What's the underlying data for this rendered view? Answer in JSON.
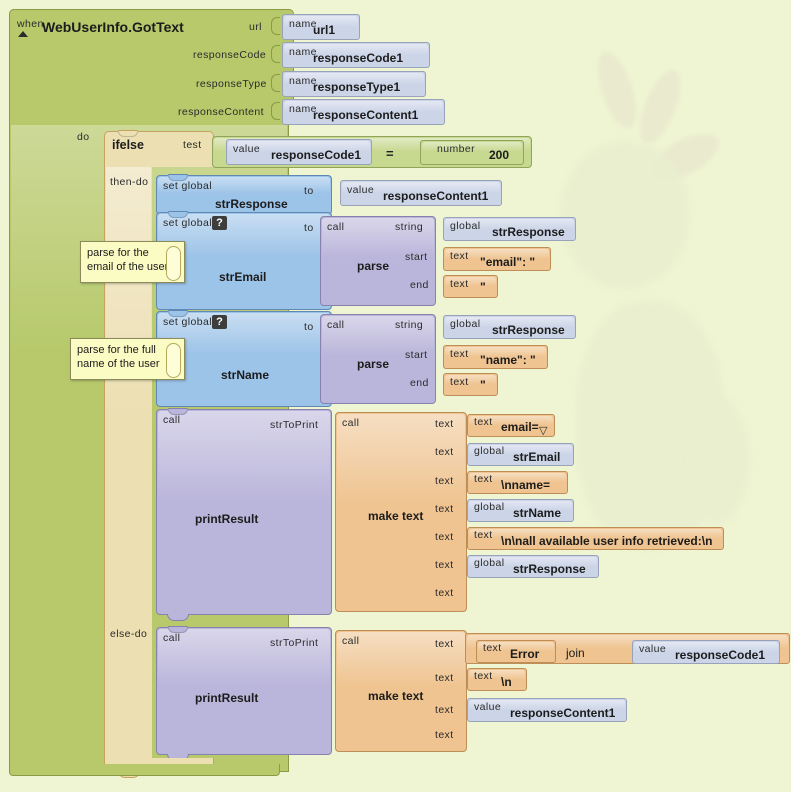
{
  "workspace": {
    "background_color": "#eff4d2",
    "watermark": "app-inventor-logo-watermark"
  },
  "event_block": {
    "type": "event",
    "color": "#b7c96b",
    "when_label": "when",
    "title": "WebUserInfo.GotText",
    "collapse_icon": "triangle-up-icon",
    "parameters": [
      {
        "label": "url",
        "kind": "name",
        "name": "url1"
      },
      {
        "label": "responseCode",
        "kind": "name",
        "name": "responseCode1"
      },
      {
        "label": "responseType",
        "kind": "name",
        "name": "responseType1"
      },
      {
        "label": "responseContent",
        "kind": "name",
        "name": "responseContent1"
      }
    ],
    "do_label": "do"
  },
  "ifelse_block": {
    "type": "control",
    "color": "#f0d6a0",
    "title": "ifelse",
    "test_label": "test",
    "then_label": "then-do",
    "else_label": "else-do",
    "test": {
      "left": {
        "kind": "value",
        "name": "responseCode1"
      },
      "operator": "=",
      "right": {
        "kind": "number",
        "value": "200"
      }
    }
  },
  "set_strResponse": {
    "type": "variable-set",
    "color": "#9cc3e8",
    "set_label": "set global",
    "variable": "strResponse",
    "to_label": "to",
    "value": {
      "kind": "value",
      "name": "responseContent1"
    }
  },
  "set_strEmail": {
    "type": "variable-set",
    "color": "#9cc3e8",
    "set_label": "set global",
    "mutator_icon": "question-mark-icon",
    "variable": "strEmail",
    "to_label": "to",
    "comment": "parse for the\nemail of the user",
    "call": {
      "call_label": "call",
      "procedure": "parse",
      "args": [
        {
          "label": "string",
          "kind": "global",
          "name": "strResponse"
        },
        {
          "label": "start",
          "kind": "text",
          "value": "\"email\": \""
        },
        {
          "label": "end",
          "kind": "text",
          "value": "\""
        }
      ]
    }
  },
  "set_strName": {
    "type": "variable-set",
    "color": "#9cc3e8",
    "set_label": "set global",
    "mutator_icon": "question-mark-icon",
    "variable": "strName",
    "to_label": "to",
    "comment": "parse for the full\nname of the user",
    "call": {
      "call_label": "call",
      "procedure": "parse",
      "args": [
        {
          "label": "string",
          "kind": "global",
          "name": "strResponse"
        },
        {
          "label": "start",
          "kind": "text",
          "value": "\"name\": \""
        },
        {
          "label": "end",
          "kind": "text",
          "value": "\""
        }
      ]
    }
  },
  "print_then": {
    "type": "procedure-call",
    "color": "#bab5da",
    "call_label": "call",
    "procedure": "printResult",
    "arg_label": "strToPrint",
    "make_text": {
      "call_label": "call",
      "title": "make text",
      "color": "#efc491",
      "slot_label": "text",
      "items": [
        {
          "kind": "text",
          "value": "email=",
          "has_dropdown": true
        },
        {
          "kind": "global",
          "name": "strEmail"
        },
        {
          "kind": "text",
          "value": "\\nname="
        },
        {
          "kind": "global",
          "name": "strName"
        },
        {
          "kind": "text",
          "value": "\\n\\nall available user info retrieved:\\n"
        },
        {
          "kind": "global",
          "name": "strResponse"
        },
        {
          "kind": "empty",
          "value": ""
        }
      ]
    }
  },
  "print_else": {
    "type": "procedure-call",
    "color": "#bab5da",
    "call_label": "call",
    "procedure": "printResult",
    "arg_label": "strToPrint",
    "make_text": {
      "call_label": "call",
      "title": "make text",
      "color": "#efc491",
      "slot_label": "text",
      "items": [
        {
          "kind": "join",
          "join_label": "join",
          "left": {
            "kind": "text",
            "value": "Error "
          },
          "right": {
            "kind": "value",
            "name": "responseCode1"
          }
        },
        {
          "kind": "text",
          "value": "\\n"
        },
        {
          "kind": "value",
          "name": "responseContent1"
        },
        {
          "kind": "empty",
          "value": ""
        }
      ]
    }
  },
  "sublabels": {
    "name": "name",
    "value": "value",
    "global": "global",
    "text": "text",
    "number": "number",
    "call": "call",
    "string": "string",
    "start": "start",
    "end": "end",
    "dropdown_icon": "triangle-down-icon"
  }
}
